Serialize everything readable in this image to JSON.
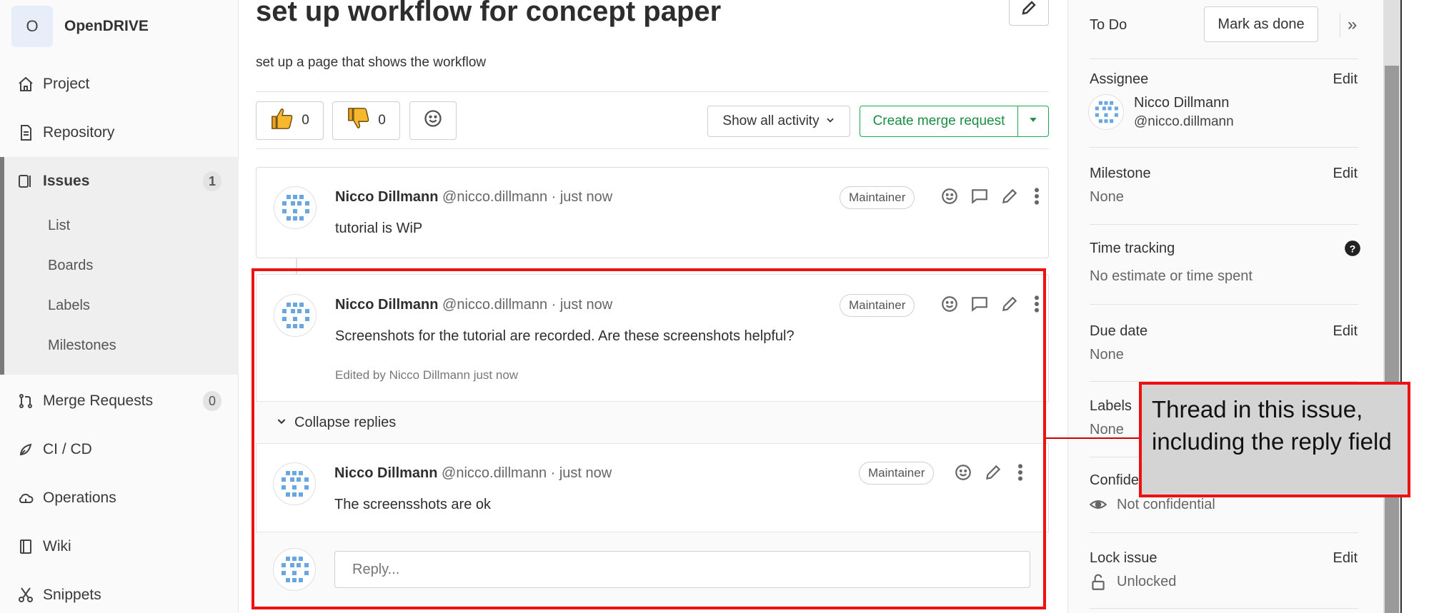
{
  "project": {
    "avatar_letter": "O",
    "name": "OpenDRIVE"
  },
  "nav": {
    "project": "Project",
    "repository": "Repository",
    "issues": "Issues",
    "issues_count": "1",
    "issues_sub": [
      "List",
      "Boards",
      "Labels",
      "Milestones"
    ],
    "merge_requests": "Merge Requests",
    "merge_requests_count": "0",
    "cicd": "CI / CD",
    "operations": "Operations",
    "wiki": "Wiki",
    "snippets": "Snippets"
  },
  "issue": {
    "title": "set up workflow for concept paper",
    "description": "set up a page that shows the workflow",
    "thumbs_up": "0",
    "thumbs_down": "0",
    "activity_filter": "Show all activity",
    "create_mr": "Create merge request"
  },
  "notes": [
    {
      "author": "Nicco Dillmann",
      "handle": "@nicco.dillmann · just now",
      "role": "Maintainer",
      "text": "tutorial is WiP"
    },
    {
      "author": "Nicco Dillmann",
      "handle": "@nicco.dillmann · just now",
      "role": "Maintainer",
      "text": "Screenshots for the tutorial are recorded. Are these screenshots helpful?",
      "edited": "Edited by Nicco Dillmann just now"
    },
    {
      "author": "Nicco Dillmann",
      "handle": "@nicco.dillmann · just now",
      "role": "Maintainer",
      "text": "The screensshots are ok"
    }
  ],
  "thread": {
    "collapse_label": "Collapse replies",
    "reply_placeholder": "Reply..."
  },
  "sidebar": {
    "todo_label": "To Do",
    "mark_done": "Mark as done",
    "collapse": "»",
    "assignee_label": "Assignee",
    "assignee_name": "Nicco Dillmann",
    "assignee_handle": "@nicco.dillmann",
    "edit": "Edit",
    "milestone_label": "Milestone",
    "milestone_value": "None",
    "time_label": "Time tracking",
    "time_value": "No estimate or time spent",
    "due_label": "Due date",
    "due_value": "None",
    "labels_label": "Labels",
    "labels_value": "None",
    "confidential_label": "Confidentiality",
    "confidential_value": "Not confidential",
    "lock_label": "Lock issue",
    "lock_value": "Unlocked"
  },
  "annotation": {
    "callout_text": "Thread in this issue, including the reply field",
    "highlight_color": "#ee1111"
  }
}
